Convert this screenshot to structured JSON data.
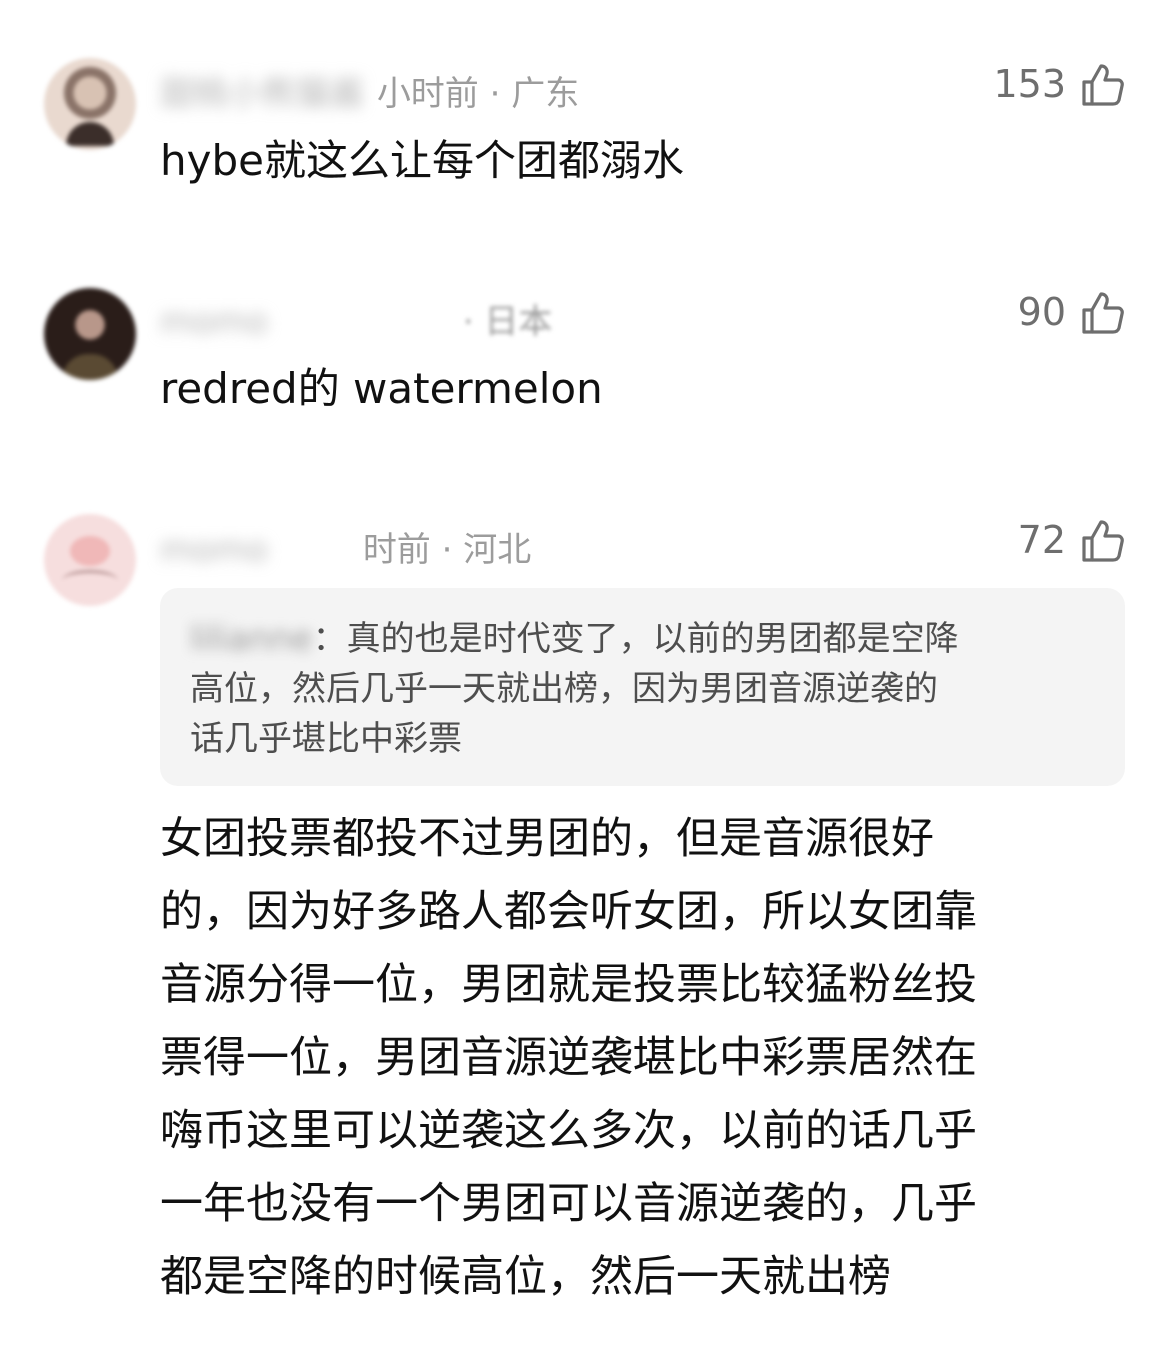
{
  "comments": [
    {
      "username": "甜桃小熊猫酱",
      "time": "1小时前",
      "location": "广东",
      "meta_rest": "小时前 · 广东",
      "likes": "153",
      "text": "hybe就这么让每个团都溺水"
    },
    {
      "username": "momo",
      "time": "",
      "location": "日本",
      "meta_rest": "· 日本",
      "likes": "90",
      "text": "redred的 watermelon"
    },
    {
      "username": "momo",
      "time": "",
      "location": "河北",
      "meta_rest": "时前 · 河北",
      "likes": "72",
      "quote": {
        "username": "lilianne",
        "lines": [
          "：真的也是时代变了，以前的男团都是空降",
          "高位，然后几乎一天就出榜，因为男团音源逆袭的",
          "话几乎堪比中彩票"
        ]
      },
      "text_lines": [
        "女团投票都投不过男团的，但是音源很好",
        "的，因为好多路人都会听女团，所以女团靠",
        "音源分得一位，男团就是投票比较猛粉丝投",
        "票得一位，男团音源逆袭堪比中彩票居然在",
        "嗨币这里可以逆袭这么多次，以前的话几乎",
        "一年也没有一个男团可以音源逆袭的，几乎",
        "都是空降的时候高位，然后一天就出榜"
      ]
    }
  ],
  "icons": {
    "like": "thumbs-up-icon"
  },
  "colors": {
    "meta": "#9c9c9c",
    "quote_bg": "#f4f4f4",
    "text": "#111111"
  }
}
